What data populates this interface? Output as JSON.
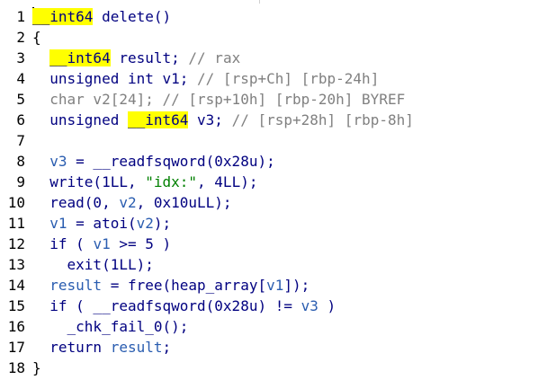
{
  "editor": {
    "lines": [
      {
        "num": "1",
        "segments": [
          [
            "cursor",
            ""
          ],
          [
            "hl",
            "__int64"
          ],
          [
            "plain",
            " delete()"
          ]
        ]
      },
      {
        "num": "2",
        "segments": [
          [
            "brace",
            "{"
          ]
        ]
      },
      {
        "num": "3",
        "segments": [
          [
            "plain",
            "  "
          ],
          [
            "hl",
            "__int64"
          ],
          [
            "plain",
            " result; "
          ],
          [
            "gray",
            "// rax"
          ]
        ]
      },
      {
        "num": "4",
        "segments": [
          [
            "plain",
            "  unsigned int v1; "
          ],
          [
            "gray",
            "// [rsp+Ch] [rbp-24h]"
          ]
        ]
      },
      {
        "num": "5",
        "segments": [
          [
            "gray",
            "  char v2[24]; // [rsp+10h] [rbp-20h] BYREF"
          ]
        ]
      },
      {
        "num": "6",
        "segments": [
          [
            "plain",
            "  unsigned "
          ],
          [
            "hl",
            "__int64"
          ],
          [
            "plain",
            " v3; "
          ],
          [
            "gray",
            "// [rsp+28h] [rbp-8h]"
          ]
        ]
      },
      {
        "num": "7",
        "segments": []
      },
      {
        "num": "8",
        "segments": [
          [
            "plain",
            "  "
          ],
          [
            "var",
            "v3"
          ],
          [
            "plain",
            " = __readfsqword(0x28u);"
          ]
        ]
      },
      {
        "num": "9",
        "segments": [
          [
            "plain",
            "  write(1LL, "
          ],
          [
            "str",
            "\"idx:\""
          ],
          [
            "plain",
            ", 4LL);"
          ]
        ]
      },
      {
        "num": "10",
        "segments": [
          [
            "plain",
            "  read(0, "
          ],
          [
            "var",
            "v2"
          ],
          [
            "plain",
            ", 0x10uLL);"
          ]
        ]
      },
      {
        "num": "11",
        "segments": [
          [
            "plain",
            "  "
          ],
          [
            "var",
            "v1"
          ],
          [
            "plain",
            " = atoi("
          ],
          [
            "var",
            "v2"
          ],
          [
            "plain",
            ");"
          ]
        ]
      },
      {
        "num": "12",
        "segments": [
          [
            "plain",
            "  if ( "
          ],
          [
            "var",
            "v1"
          ],
          [
            "plain",
            " >= 5 )"
          ]
        ]
      },
      {
        "num": "13",
        "segments": [
          [
            "plain",
            "    exit(1LL);"
          ]
        ]
      },
      {
        "num": "14",
        "segments": [
          [
            "plain",
            "  "
          ],
          [
            "var",
            "result"
          ],
          [
            "plain",
            " = free(heap_array["
          ],
          [
            "var",
            "v1"
          ],
          [
            "plain",
            "]);"
          ]
        ]
      },
      {
        "num": "15",
        "segments": [
          [
            "plain",
            "  if ( __readfsqword(0x28u) != "
          ],
          [
            "var",
            "v3"
          ],
          [
            "plain",
            " )"
          ]
        ]
      },
      {
        "num": "16",
        "segments": [
          [
            "plain",
            "    _chk_fail_0();"
          ]
        ]
      },
      {
        "num": "17",
        "segments": [
          [
            "plain",
            "  return "
          ],
          [
            "var",
            "result"
          ],
          [
            "plain",
            ";"
          ]
        ]
      },
      {
        "num": "18",
        "segments": [
          [
            "brace",
            "}"
          ]
        ]
      }
    ]
  }
}
